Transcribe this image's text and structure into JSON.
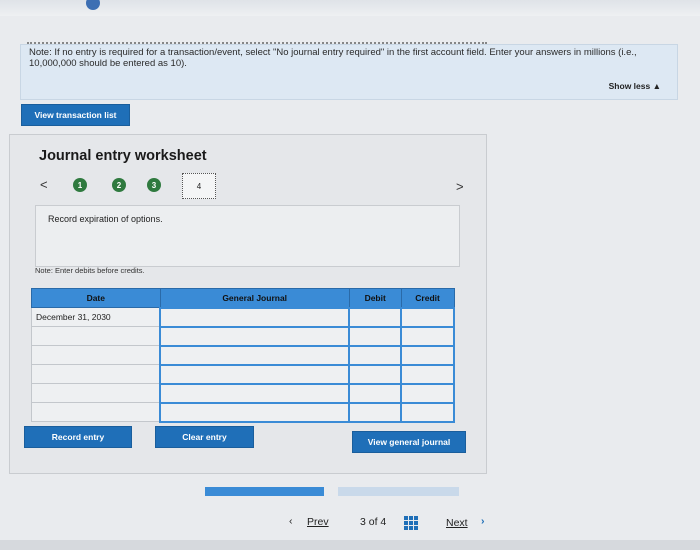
{
  "note": {
    "text": "Note: If no entry is required for a transaction/event, select \"No journal entry required\" in the first account field. Enter your answers in millions (i.e., 10,000,000 should be entered as 10).",
    "show_less": "Show less ▲"
  },
  "buttons": {
    "view_transaction_list": "View transaction list",
    "record_entry": "Record entry",
    "clear_entry": "Clear entry",
    "view_general_journal": "View general journal"
  },
  "worksheet": {
    "title": "Journal entry worksheet",
    "steps": [
      "1",
      "2",
      "3",
      "4"
    ],
    "prev_arrow": "<",
    "next_arrow": ">",
    "description": "Record expiration of options.",
    "note_debits": "Note: Enter debits before credits."
  },
  "journal": {
    "headers": [
      "Date",
      "General Journal",
      "Debit",
      "Credit"
    ],
    "rows": [
      [
        "December 31, 2030",
        "",
        "",
        ""
      ],
      [
        "",
        "",
        "",
        ""
      ],
      [
        "",
        "",
        "",
        ""
      ],
      [
        "",
        "",
        "",
        ""
      ],
      [
        "",
        "",
        "",
        ""
      ],
      [
        "",
        "",
        "",
        ""
      ]
    ]
  },
  "pagination": {
    "prev": "Prev",
    "position": "3 of 4",
    "next": "Next"
  },
  "colors": {
    "accent": "#1f6fb8",
    "step_done": "#2f7a3f",
    "table_header": "#3a8bd6"
  }
}
